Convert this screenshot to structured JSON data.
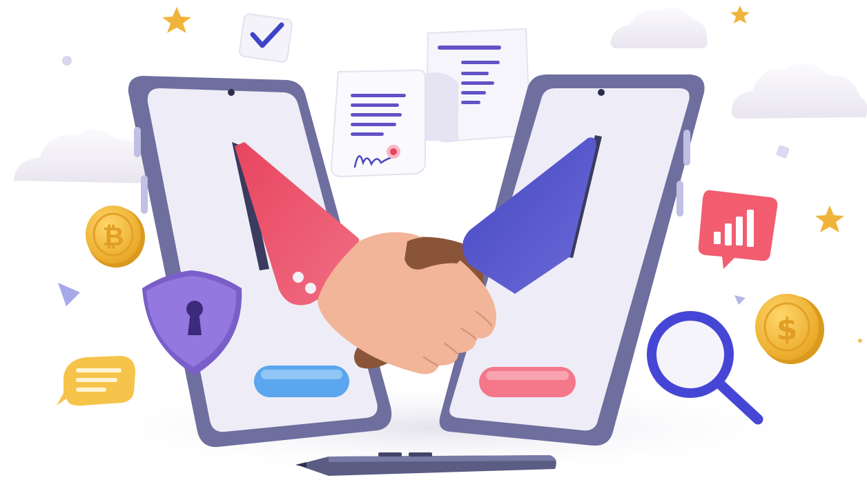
{
  "illustration": {
    "colors": {
      "phone_frame": "#6E6F9E",
      "phone_screen": "#EEEDF7",
      "left_sleeve": "#E8455F",
      "right_sleeve": "#5252C9",
      "light_hand": "#F2B59A",
      "dark_hand": "#8A5438",
      "blue_button": "#5BA6EE",
      "pink_button": "#F4778A",
      "coin": "#F2B52F",
      "shield": "#8F73DD",
      "magnifier": "#4646D6",
      "chart_card": "#F25D70",
      "chat_bubble": "#F6C44A",
      "cloud": "#F1EEF5",
      "document_lines": "#6152C6",
      "checkmark": "#3E43C8",
      "star": "#F0B43A",
      "stylus": "#5B5C84"
    },
    "icons": [
      "left-phone-icon",
      "right-phone-icon",
      "handshake-icon",
      "document-icon",
      "signed-contract-icon",
      "checkbox-icon",
      "bitcoin-coin-icon",
      "dollar-coin-icon",
      "shield-lock-icon",
      "magnifier-icon",
      "bar-chart-icon",
      "chat-bubble-icon",
      "cloud-icon",
      "star-icon",
      "stylus-pen-icon"
    ]
  }
}
